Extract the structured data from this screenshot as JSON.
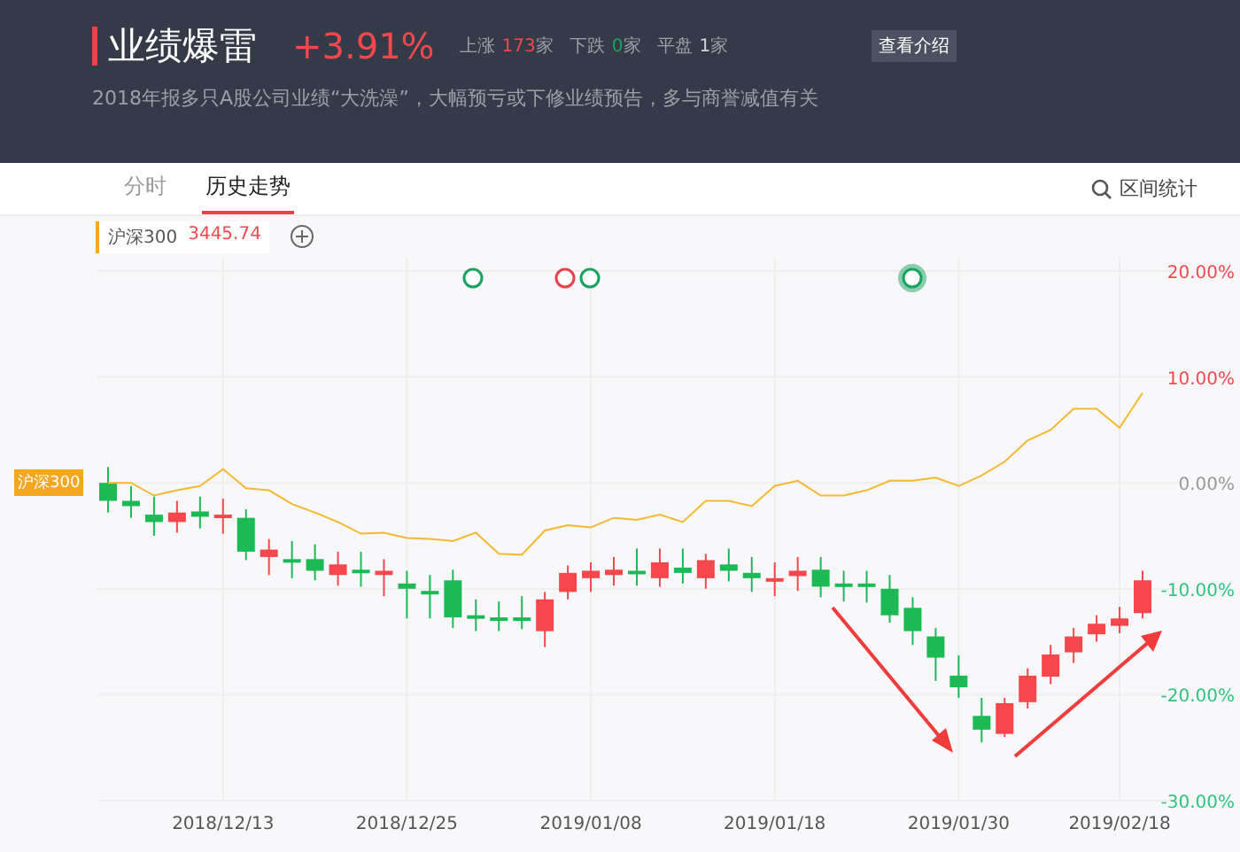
{
  "header": {
    "title": "业绩爆雷",
    "change": "+3.91%",
    "stats": [
      {
        "label": "上涨",
        "value": "173",
        "unit": "家",
        "kind": "up"
      },
      {
        "label": "下跌",
        "value": "0",
        "unit": "家",
        "kind": "down"
      },
      {
        "label": "平盘",
        "value": "1",
        "unit": "家",
        "kind": "flat"
      }
    ],
    "intro_button": "查看介绍",
    "description": "2018年报多只A股公司业绩“大洗澡”，大幅预亏或下修业绩预告，多与商誉减值有关"
  },
  "tabs": [
    {
      "label": "分时",
      "selected": false
    },
    {
      "label": "历史走势",
      "selected": true
    }
  ],
  "stats_button": "区间统计",
  "index_chip": {
    "name": "沪深300",
    "value": "3445.74"
  },
  "chart": {
    "event_markers": [
      {
        "color": "#1aa260",
        "selected": false
      },
      {
        "color": "#e8424a",
        "selected": false
      },
      {
        "color": "#1aa260",
        "selected": false
      },
      {
        "color": "#1aa260",
        "selected": true
      }
    ],
    "chart_data": {
      "type": "candlestick",
      "grid": true,
      "ylim": [
        -30,
        20
      ],
      "yticks": [
        {
          "value": 20,
          "label": "20.00%"
        },
        {
          "value": 10,
          "label": "10.00%"
        },
        {
          "value": 0,
          "label": "0.00%"
        },
        {
          "value": -10,
          "label": "-10.00%"
        },
        {
          "value": -20,
          "label": "-20.00%"
        },
        {
          "value": -30,
          "label": "-30.00%"
        }
      ],
      "categories": [
        null,
        null,
        null,
        null,
        null,
        "2018/12/13",
        null,
        null,
        null,
        null,
        null,
        null,
        null,
        "2018/12/25",
        null,
        null,
        null,
        null,
        null,
        null,
        null,
        "2019/01/08",
        null,
        null,
        null,
        null,
        null,
        null,
        null,
        "2019/01/18",
        null,
        null,
        null,
        null,
        null,
        null,
        null,
        "2019/01/30",
        null,
        null,
        null,
        null,
        null,
        null,
        "2019/02/18",
        null
      ],
      "ohlc": [
        [
          0,
          1.5,
          -2.8,
          -1.7
        ],
        [
          -1.7,
          -0.3,
          -3.3,
          -2.2
        ],
        [
          -3,
          -1.3,
          -5,
          -3.7
        ],
        [
          -3.7,
          -1.7,
          -4.7,
          -2.8
        ],
        [
          -2.7,
          -1.3,
          -4.3,
          -3.2
        ],
        [
          -3.2,
          -1.5,
          -4.8,
          -3
        ],
        [
          -3.3,
          -2.5,
          -7.3,
          -6.5
        ],
        [
          -7,
          -5.3,
          -8.7,
          -6.3
        ],
        [
          -7.2,
          -5.5,
          -9,
          -7.3
        ],
        [
          -7.2,
          -5.8,
          -9.2,
          -8.3
        ],
        [
          -8.7,
          -6.5,
          -9.7,
          -7.7
        ],
        [
          -8.2,
          -6.5,
          -9.8,
          -8.3
        ],
        [
          -8.7,
          -7.2,
          -10.7,
          -8.3
        ],
        [
          -9.5,
          -8.3,
          -12.8,
          -10
        ],
        [
          -10.2,
          -8.7,
          -12.8,
          -10.3
        ],
        [
          -9.2,
          -8.2,
          -13.7,
          -12.7
        ],
        [
          -12.5,
          -11,
          -14,
          -12.8
        ],
        [
          -12.7,
          -11.2,
          -14,
          -12.8
        ],
        [
          -12.7,
          -10.7,
          -13.8,
          -13
        ],
        [
          -14,
          -10.3,
          -15.5,
          -11
        ],
        [
          -10.3,
          -7.8,
          -11,
          -8.5
        ],
        [
          -9,
          -7.5,
          -10.3,
          -8.3
        ],
        [
          -8.7,
          -7,
          -9.7,
          -8.2
        ],
        [
          -8.3,
          -6.2,
          -9.7,
          -8.5
        ],
        [
          -9,
          -6.2,
          -9.8,
          -7.5
        ],
        [
          -8,
          -6.2,
          -9.5,
          -8.5
        ],
        [
          -9,
          -6.7,
          -10,
          -7.3
        ],
        [
          -7.7,
          -6.2,
          -9.3,
          -8.3
        ],
        [
          -8.5,
          -7,
          -10.3,
          -9
        ],
        [
          -9.2,
          -7.5,
          -10.7,
          -9
        ],
        [
          -8.8,
          -7,
          -10.2,
          -8.3
        ],
        [
          -8.2,
          -7,
          -10.8,
          -9.8
        ],
        [
          -9.5,
          -8.3,
          -11.2,
          -9.7
        ],
        [
          -9.5,
          -8.3,
          -11.3,
          -9.8
        ],
        [
          -10,
          -8.7,
          -13.2,
          -12.5
        ],
        [
          -11.8,
          -10.8,
          -15.3,
          -14
        ],
        [
          -14.5,
          -13.7,
          -18.7,
          -16.5
        ],
        [
          -18.2,
          -16.3,
          -20.3,
          -19.3
        ],
        [
          -22,
          -20.3,
          -24.5,
          -23.3
        ],
        [
          -23.7,
          -20.3,
          -24,
          -20.8
        ],
        [
          -20.7,
          -17.5,
          -21.3,
          -18.2
        ],
        [
          -18.3,
          -15.3,
          -19,
          -16.2
        ],
        [
          -16,
          -13.7,
          -17,
          -14.5
        ],
        [
          -14.3,
          -12.5,
          -15,
          -13.3
        ],
        [
          -13.5,
          -11.7,
          -14.2,
          -12.8
        ],
        [
          -12.3,
          -8.3,
          -12.8,
          -9.2
        ]
      ]
    },
    "index_line": {
      "chart_data": {
        "type": "line",
        "ylim": [
          -30,
          20
        ],
        "series": [
          {
            "name": "沪深300",
            "color": "#f7b733",
            "values": [
              0,
              0,
              -1.2,
              -0.7,
              -0.3,
              1.3,
              -0.5,
              -0.7,
              -2,
              -2.8,
              -3.7,
              -4.8,
              -4.7,
              -5.2,
              -5.3,
              -5.5,
              -4.7,
              -6.7,
              -6.8,
              -4.5,
              -4,
              -4.2,
              -3.3,
              -3.5,
              -3,
              -3.7,
              -1.7,
              -1.7,
              -2.2,
              -0.3,
              0.2,
              -1.2,
              -1.2,
              -0.7,
              0.2,
              0.2,
              0.5,
              -0.3,
              0.7,
              2,
              4,
              5,
              7,
              7,
              5.2,
              8.5
            ]
          }
        ]
      }
    }
  }
}
